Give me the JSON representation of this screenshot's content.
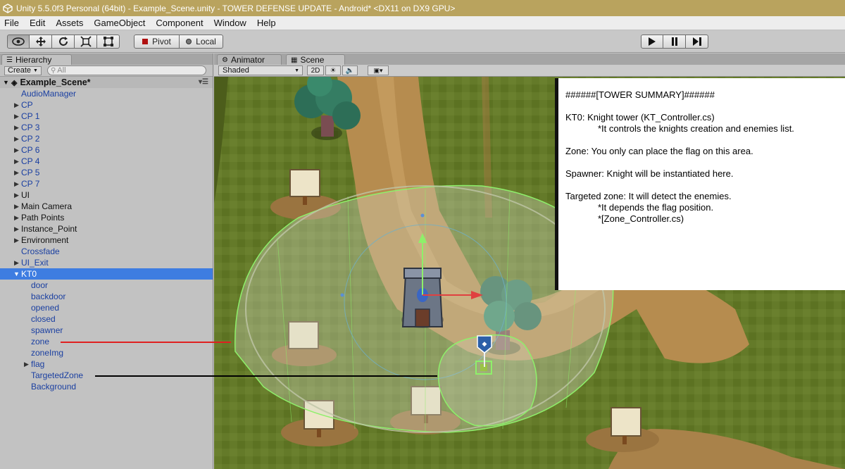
{
  "window": {
    "title": "Unity 5.5.0f3 Personal (64bit) - Example_Scene.unity - TOWER DEFENSE UPDATE - Android* <DX11 on DX9 GPU>"
  },
  "menu": [
    "File",
    "Edit",
    "Assets",
    "GameObject",
    "Component",
    "Window",
    "Help"
  ],
  "toolbar": {
    "pivot_label": "Pivot",
    "local_label": "Local"
  },
  "hierarchy": {
    "tab_label": "Hierarchy",
    "create_label": "Create",
    "search_placeholder": "All",
    "scene_name": "Example_Scene*",
    "items": [
      {
        "label": "AudioManager",
        "arrow": "",
        "depth": 0,
        "blue": true
      },
      {
        "label": "CP",
        "arrow": "▶",
        "depth": 0,
        "blue": true
      },
      {
        "label": "CP 1",
        "arrow": "▶",
        "depth": 0,
        "blue": true
      },
      {
        "label": "CP 3",
        "arrow": "▶",
        "depth": 0,
        "blue": true
      },
      {
        "label": "CP 2",
        "arrow": "▶",
        "depth": 0,
        "blue": true
      },
      {
        "label": "CP 6",
        "arrow": "▶",
        "depth": 0,
        "blue": true
      },
      {
        "label": "CP 4",
        "arrow": "▶",
        "depth": 0,
        "blue": true
      },
      {
        "label": "CP 5",
        "arrow": "▶",
        "depth": 0,
        "blue": true
      },
      {
        "label": "CP 7",
        "arrow": "▶",
        "depth": 0,
        "blue": true
      },
      {
        "label": "UI",
        "arrow": "▶",
        "depth": 0,
        "blue": false
      },
      {
        "label": "Main Camera",
        "arrow": "▶",
        "depth": 0,
        "blue": false
      },
      {
        "label": "Path Points",
        "arrow": "▶",
        "depth": 0,
        "blue": false
      },
      {
        "label": "Instance_Point",
        "arrow": "▶",
        "depth": 0,
        "blue": false
      },
      {
        "label": "Environment",
        "arrow": "▶",
        "depth": 0,
        "blue": false
      },
      {
        "label": "Crossfade",
        "arrow": "",
        "depth": 0,
        "blue": true
      },
      {
        "label": "UI_Exit",
        "arrow": "▶",
        "depth": 0,
        "blue": true
      },
      {
        "label": "KT0",
        "arrow": "▼",
        "depth": 0,
        "blue": true,
        "selected": true
      },
      {
        "label": "door",
        "arrow": "",
        "depth": 1,
        "blue": true
      },
      {
        "label": "backdoor",
        "arrow": "",
        "depth": 1,
        "blue": true
      },
      {
        "label": "opened",
        "arrow": "",
        "depth": 1,
        "blue": true
      },
      {
        "label": "closed",
        "arrow": "",
        "depth": 1,
        "blue": true
      },
      {
        "label": "spawner",
        "arrow": "",
        "depth": 1,
        "blue": true
      },
      {
        "label": "zone",
        "arrow": "",
        "depth": 1,
        "blue": true
      },
      {
        "label": "zoneImg",
        "arrow": "",
        "depth": 1,
        "blue": true
      },
      {
        "label": "flag",
        "arrow": "▶",
        "depth": 1,
        "blue": true
      },
      {
        "label": "TargetedZone",
        "arrow": "",
        "depth": 1,
        "blue": true
      },
      {
        "label": "Background",
        "arrow": "",
        "depth": 1,
        "blue": true
      }
    ]
  },
  "scene": {
    "tab_animator": "Animator",
    "tab_scene": "Scene",
    "shading_mode": "Shaded",
    "mode_2d": "2D"
  },
  "summary": {
    "title": "######[TOWER SUMMARY]######",
    "kt0_line": "KT0: Knight tower (KT_Controller.cs)",
    "kt0_note": "*It controls the knights creation and enemies list.",
    "zone_line": "Zone: You only can place the flag on this area.",
    "spawner_line": "Spawner: Knight will be instantiated here.",
    "targeted_line": "Targeted zone: It will detect the enemies.",
    "targeted_note1": "*It depends the flag position.",
    "targeted_note2": "*[Zone_Controller.cs)"
  },
  "colors": {
    "title_bar": "#b9a35e",
    "selection": "#3e7de1",
    "zone_annotation_line": "#e02020",
    "targeted_annotation_line": "#000000",
    "gizmo_green": "#8ef06a"
  }
}
